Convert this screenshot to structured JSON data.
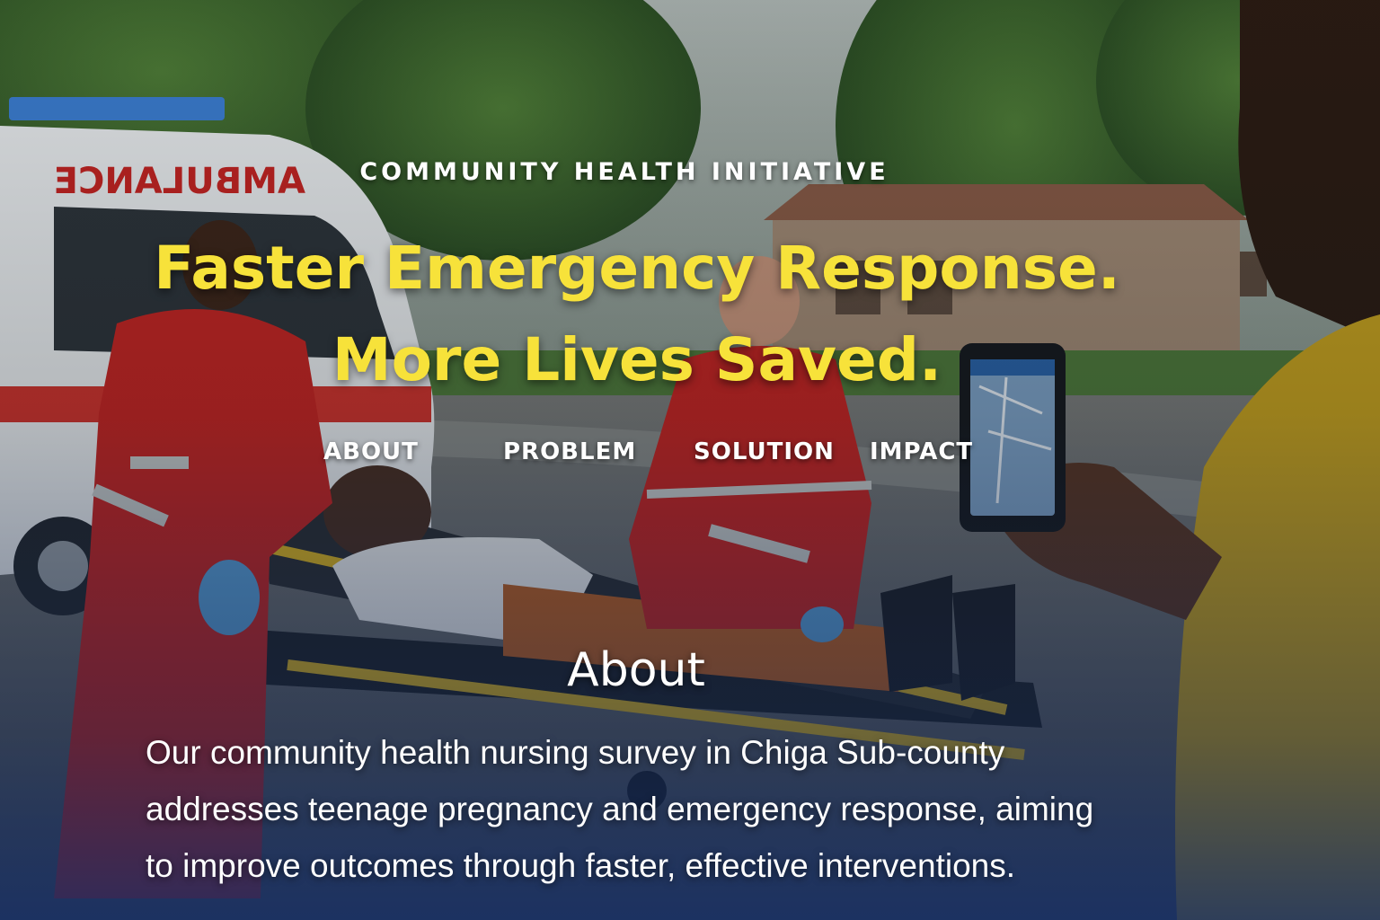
{
  "eyebrow": "COMMUNITY HEALTH INITIATIVE",
  "headline": {
    "line1": "Faster Emergency Response.",
    "line2": "More Lives Saved."
  },
  "nav": {
    "items": [
      "ABOUT",
      "PROBLEM",
      "SOLUTION",
      "IMPACT"
    ]
  },
  "about": {
    "title": "About",
    "text": "Our community health nursing survey in Chiga Sub-county addresses teenage pregnancy and emergency response, aiming to improve outcomes through faster, effective interventions."
  },
  "background": {
    "vehicle_text": "AMBULANCE",
    "colors": {
      "headline": "#f7e23a",
      "uniform": "#c8231f",
      "sky": "#9aa6a2",
      "foliage": "#3f6a2c"
    }
  }
}
